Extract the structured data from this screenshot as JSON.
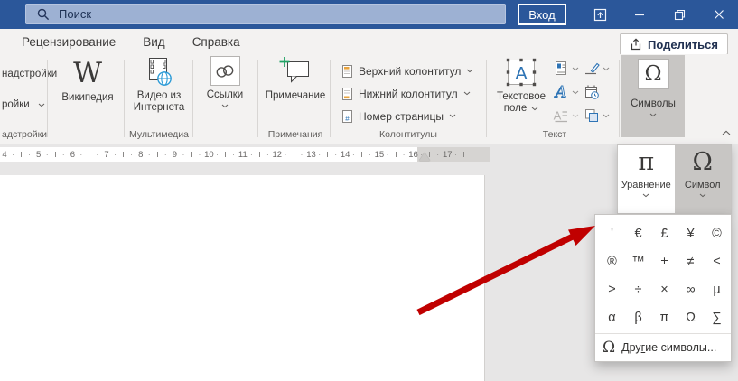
{
  "titlebar": {
    "search": "Поиск",
    "signin": "Вход"
  },
  "tabs": [
    "Рецензирование",
    "Вид",
    "Справка"
  ],
  "share": "Поделиться",
  "ribbon": {
    "addins": {
      "frag_top": "надстройки",
      "frag_mid": "ройки",
      "group_label": "адстройки"
    },
    "wikipedia": {
      "glyph": "W",
      "label": "Википедия"
    },
    "media": {
      "label1": "Видео из",
      "label2": "Интернета",
      "group_label": "Мультимедиа"
    },
    "links": {
      "label": "Ссылки"
    },
    "comment": {
      "label": "Примечание",
      "group_label": "Примечания"
    },
    "header_footer": {
      "items": [
        {
          "icon": "header-icon",
          "label": "Верхний колонтитул"
        },
        {
          "icon": "footer-icon",
          "label": "Нижний колонтитул"
        },
        {
          "icon": "page-number-icon",
          "label": "Номер страницы"
        }
      ],
      "group_label": "Колонтитулы"
    },
    "text": {
      "textbox_label1": "Текстовое",
      "textbox_label2": "поле",
      "group_label": "Текст"
    },
    "symbols": {
      "glyph": "Ω",
      "label": "Символы"
    }
  },
  "ruler": {
    "numbers": [
      4,
      5,
      6,
      7,
      8,
      9,
      10,
      11,
      12,
      13,
      14,
      15,
      16,
      17
    ]
  },
  "flyout": {
    "equation": {
      "glyph": "π",
      "label": "Уравнение"
    },
    "symbol": {
      "glyph": "Ω",
      "label": "Символ"
    }
  },
  "symbol_menu": {
    "symbols": [
      "'",
      "€",
      "£",
      "¥",
      "©",
      "®",
      "™",
      "±",
      "≠",
      "≤",
      "≥",
      "÷",
      "×",
      "∞",
      "µ",
      "α",
      "β",
      "π",
      "Ω",
      "∑"
    ],
    "more": {
      "glyph": "Ω",
      "prefix": "Дру",
      "accel": "г",
      "suffix": "ие символы..."
    }
  },
  "colors": {
    "titlebar": "#2b579a",
    "accent_red": "#c00000",
    "pressed": "#c8c6c4"
  }
}
